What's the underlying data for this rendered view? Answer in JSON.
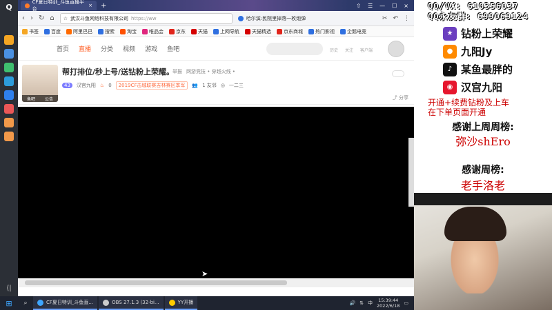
{
  "dock": {
    "logo": "Q",
    "apps": [
      {
        "name": "app-1",
        "color": "#f5a623"
      },
      {
        "name": "app-2",
        "color": "#4a90e2"
      },
      {
        "name": "app-3",
        "color": "#3fbf6f"
      },
      {
        "name": "app-4",
        "color": "#2d9cdb"
      },
      {
        "name": "app-5",
        "color": "#2f80ed"
      },
      {
        "name": "app-6",
        "color": "#eb5757"
      },
      {
        "name": "app-7",
        "color": "#f2994a"
      },
      {
        "name": "app-8",
        "color": "#f2994a"
      }
    ],
    "collapse": "⟨|"
  },
  "browser": {
    "tab_title": "CF夏日特训_斗鱼直播平台",
    "tab_close": "×",
    "new_tab": "+",
    "window_controls": [
      "⇧",
      "☰",
      "—",
      "☐",
      "×"
    ],
    "nav": {
      "back": "‹",
      "forward": "›",
      "reload": "↻",
      "home": "⌂"
    },
    "site_name": "武汉斗鱼网络科技有限公司",
    "url": "https://ww",
    "hot_news": "哈尔滨:民院里掉落一枚炮弹",
    "bookmarks": [
      {
        "label": "书签",
        "color": "#f5a623"
      },
      {
        "label": "百度",
        "color": "#2f6fe0"
      },
      {
        "label": "阿里巴巴",
        "color": "#ff6a00"
      },
      {
        "label": "搜索",
        "color": "#2f6fe0"
      },
      {
        "label": "淘宝",
        "color": "#ff5000"
      },
      {
        "label": "唯品会",
        "color": "#e0267d"
      },
      {
        "label": "京东",
        "color": "#e1251b"
      },
      {
        "label": "天猫",
        "color": "#d50000"
      },
      {
        "label": "上网导航",
        "color": "#2f6fe0"
      },
      {
        "label": "天猫精选",
        "color": "#d50000"
      },
      {
        "label": "京东商城",
        "color": "#e1251b"
      },
      {
        "label": "热门影视",
        "color": "#2f6fe0"
      },
      {
        "label": "企鹅电竞",
        "color": "#2f6fe0"
      }
    ]
  },
  "site": {
    "nav": [
      "首页",
      "直播",
      "分类",
      "视频",
      "游戏",
      "鱼吧"
    ],
    "active": "直播",
    "right_links": [
      "历史",
      "关注",
      "客户端"
    ]
  },
  "room": {
    "title": "帮打排位/秒上号/送钻粉上荣耀。",
    "report": "举报",
    "category": "网游竞技 • 穿越火线 •",
    "level": "43",
    "streamer": "汉宫九阳",
    "fire": "0",
    "tag": "2019CF击城联赛吉林赛区季军",
    "friends": "1 友邻",
    "rank": "一二三",
    "pic_labels": [
      "鱼吧",
      "公告"
    ],
    "share": "分享"
  },
  "overlay": {
    "qq_vx": "QQ/VX: 610356037",
    "qq_friends": "QQ永友群: 699069124",
    "socials": [
      {
        "icon": "king-glory-icon",
        "label": "钻粉上荣耀",
        "color": "#6b3fbf"
      },
      {
        "icon": "douyu-icon",
        "label": "九阳Jy",
        "color": "#ff8a00"
      },
      {
        "icon": "douyin-icon",
        "label": "某鱼最胖的",
        "color": "#111111"
      },
      {
        "icon": "weibo-icon",
        "label": "汉宫九阳",
        "color": "#e6162d"
      }
    ],
    "promo_line1": "开通+续费钻粉及上车",
    "promo_line2": "在下单页面开通",
    "thanks_last_week": "感谢上周周榜:",
    "last_week_name": "弥沙shEro",
    "thanks_week": "感谢周榜:",
    "week_name": "老手洛老"
  },
  "taskbar": {
    "items": [
      {
        "label": "CF夏日特训_斗鱼直...",
        "color": "#3ea6ff"
      },
      {
        "label": "OBS 27.1.3 (32-bi...",
        "color": "#cccccc"
      },
      {
        "label": "YY开播",
        "color": "#ffcc00"
      }
    ],
    "tray_lang": "中",
    "time": "15:39:44",
    "date": "2022/6/18"
  }
}
